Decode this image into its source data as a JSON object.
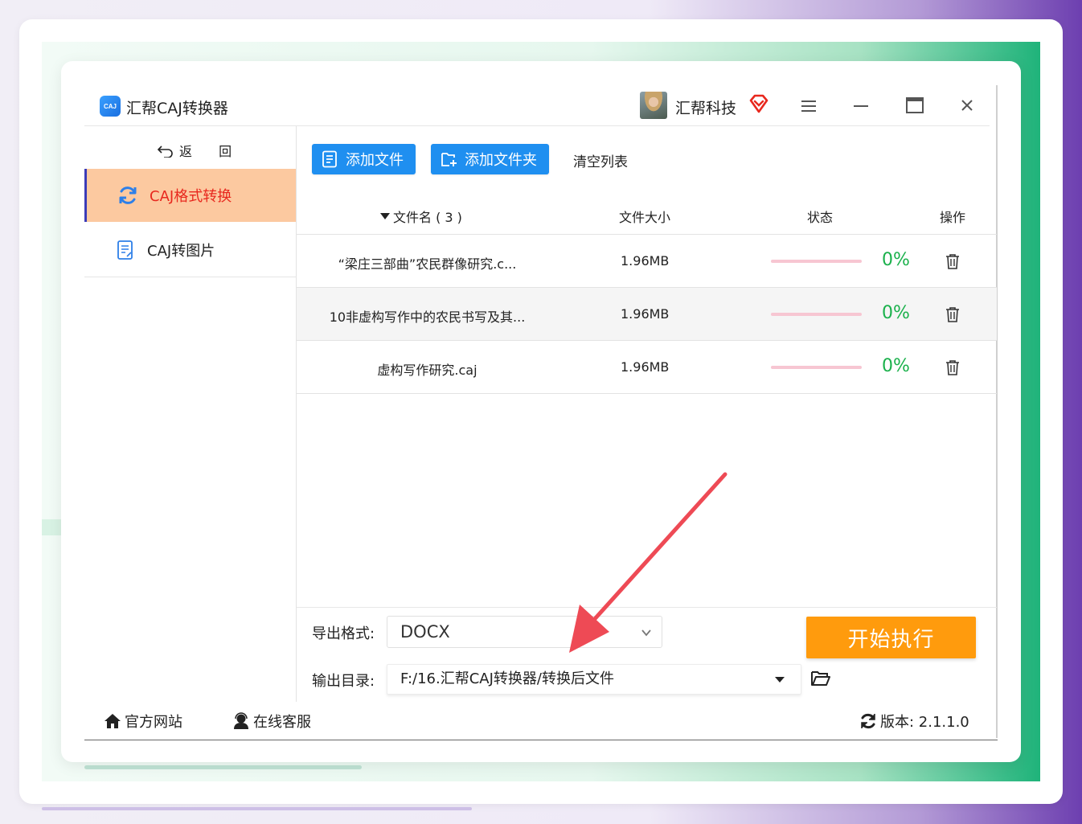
{
  "app": {
    "logo_text": "CAJ",
    "title": "汇帮CAJ转换器",
    "user_name": "汇帮科技"
  },
  "sidebar": {
    "back_label": "返 回",
    "items": [
      {
        "label": "CAJ格式转换",
        "active": true
      },
      {
        "label": "CAJ转图片",
        "active": false
      }
    ]
  },
  "toolbar": {
    "add_file": "添加文件",
    "add_folder": "添加文件夹",
    "clear_list": "清空列表"
  },
  "table": {
    "headers": {
      "name": "文件名 ( 3 )",
      "size": "文件大小",
      "status": "状态",
      "action": "操作"
    },
    "rows": [
      {
        "name": "“梁庄三部曲”农民群像研究.c...",
        "size": "1.96MB",
        "progress": 0,
        "progress_text": "0%"
      },
      {
        "name": "10非虚构写作中的农民书写及其...",
        "size": "1.96MB",
        "progress": 0,
        "progress_text": "0%"
      },
      {
        "name": "虚构写作研究.caj",
        "size": "1.96MB",
        "progress": 0,
        "progress_text": "0%"
      }
    ]
  },
  "output": {
    "format_label": "导出格式:",
    "format_value": "DOCX",
    "dir_label": "输出目录:",
    "dir_value": "F:/16.汇帮CAJ转换器/转换后文件",
    "start_button": "开始执行"
  },
  "footer": {
    "website": "官方网站",
    "support": "在线客服",
    "version": "版本:  2.1.1.0"
  },
  "colors": {
    "accent_blue": "#1f8ff0",
    "active_nav_bg": "#fcc9a0",
    "active_nav_text": "#e8281e",
    "start_button": "#ff9b0d",
    "progress_text": "#1bb14c",
    "progress_track": "#f7c6d2",
    "annotation_arrow": "#ee4a55"
  }
}
